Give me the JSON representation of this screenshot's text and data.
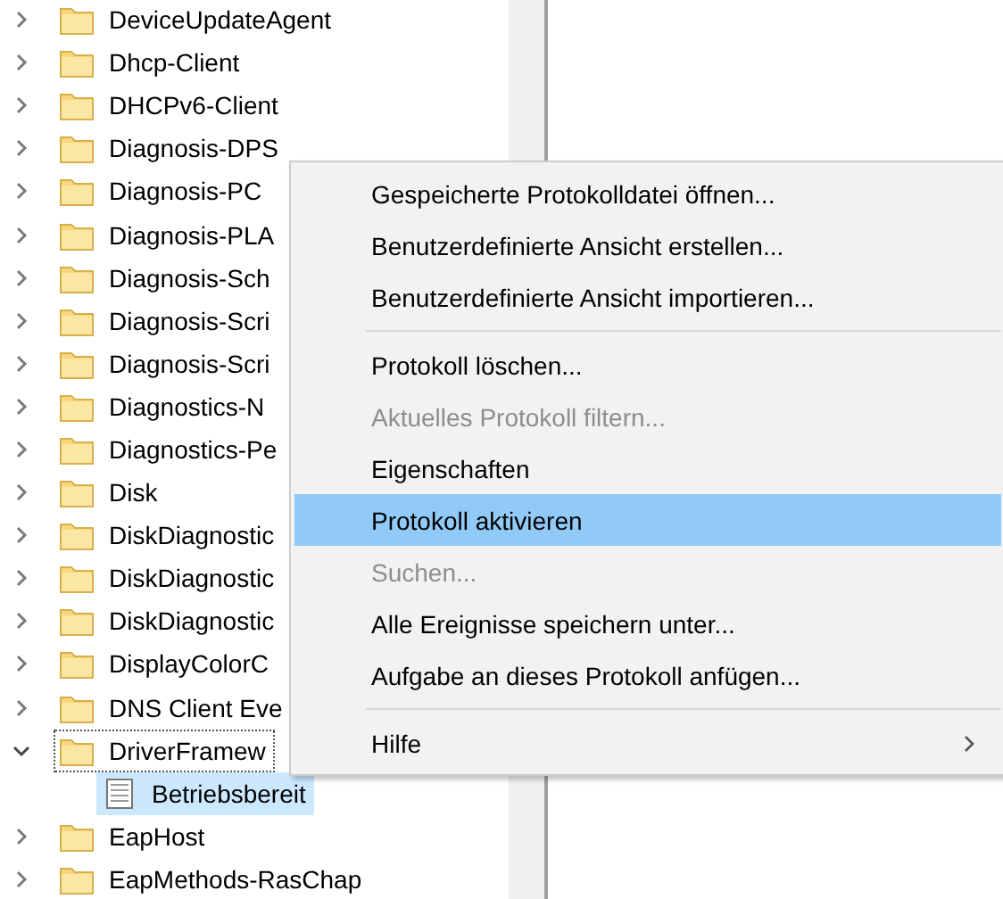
{
  "tree": {
    "items": [
      {
        "label": "DeviceUpdateAgent",
        "kind": "folder",
        "expanded": false,
        "selected": false,
        "focused": false
      },
      {
        "label": "Dhcp-Client",
        "kind": "folder",
        "expanded": false,
        "selected": false,
        "focused": false
      },
      {
        "label": "DHCPv6-Client",
        "kind": "folder",
        "expanded": false,
        "selected": false,
        "focused": false
      },
      {
        "label": "Diagnosis-DPS",
        "kind": "folder",
        "expanded": false,
        "selected": false,
        "focused": false
      },
      {
        "label": "Diagnosis-PC",
        "kind": "folder",
        "expanded": false,
        "selected": false,
        "focused": false
      },
      {
        "label": "Diagnosis-PLA",
        "kind": "folder",
        "expanded": false,
        "selected": false,
        "focused": false
      },
      {
        "label": "Diagnosis-Sch",
        "kind": "folder",
        "expanded": false,
        "selected": false,
        "focused": false
      },
      {
        "label": "Diagnosis-Scri",
        "kind": "folder",
        "expanded": false,
        "selected": false,
        "focused": false
      },
      {
        "label": "Diagnosis-Scri",
        "kind": "folder",
        "expanded": false,
        "selected": false,
        "focused": false
      },
      {
        "label": "Diagnostics-N",
        "kind": "folder",
        "expanded": false,
        "selected": false,
        "focused": false
      },
      {
        "label": "Diagnostics-Pe",
        "kind": "folder",
        "expanded": false,
        "selected": false,
        "focused": false
      },
      {
        "label": "Disk",
        "kind": "folder",
        "expanded": false,
        "selected": false,
        "focused": false
      },
      {
        "label": "DiskDiagnostic",
        "kind": "folder",
        "expanded": false,
        "selected": false,
        "focused": false
      },
      {
        "label": "DiskDiagnostic",
        "kind": "folder",
        "expanded": false,
        "selected": false,
        "focused": false
      },
      {
        "label": "DiskDiagnostic",
        "kind": "folder",
        "expanded": false,
        "selected": false,
        "focused": false
      },
      {
        "label": "DisplayColorC",
        "kind": "folder",
        "expanded": false,
        "selected": false,
        "focused": false
      },
      {
        "label": "DNS Client Eve",
        "kind": "folder",
        "expanded": false,
        "selected": false,
        "focused": false
      },
      {
        "label": "DriverFramew",
        "kind": "folder",
        "expanded": true,
        "selected": false,
        "focused": true,
        "children": [
          {
            "label": "Betriebsbereit",
            "kind": "log",
            "selected": true,
            "focused": false
          }
        ]
      },
      {
        "label": "EapHost",
        "kind": "folder",
        "expanded": false,
        "selected": false,
        "focused": false
      },
      {
        "label": "EapMethods-RasChap",
        "kind": "folder",
        "expanded": false,
        "selected": false,
        "focused": false
      }
    ]
  },
  "context_menu": {
    "items": [
      {
        "kind": "item",
        "label": "Gespeicherte Protokolldatei öffnen...",
        "disabled": false,
        "selected": false
      },
      {
        "kind": "item",
        "label": "Benutzerdefinierte Ansicht erstellen...",
        "disabled": false,
        "selected": false
      },
      {
        "kind": "item",
        "label": "Benutzerdefinierte Ansicht importieren...",
        "disabled": false,
        "selected": false
      },
      {
        "kind": "separator"
      },
      {
        "kind": "item",
        "label": "Protokoll löschen...",
        "disabled": false,
        "selected": false
      },
      {
        "kind": "item",
        "label": "Aktuelles Protokoll filtern...",
        "disabled": true,
        "selected": false
      },
      {
        "kind": "item",
        "label": "Eigenschaften",
        "disabled": false,
        "selected": false
      },
      {
        "kind": "item",
        "label": "Protokoll aktivieren",
        "disabled": false,
        "selected": true
      },
      {
        "kind": "item",
        "label": "Suchen...",
        "disabled": true,
        "selected": false
      },
      {
        "kind": "item",
        "label": "Alle Ereignisse speichern unter...",
        "disabled": false,
        "selected": false
      },
      {
        "kind": "item",
        "label": "Aufgabe an dieses Protokoll anfügen...",
        "disabled": false,
        "selected": false
      },
      {
        "kind": "separator"
      },
      {
        "kind": "submenu",
        "label": "Hilfe",
        "disabled": false,
        "selected": false
      }
    ]
  }
}
